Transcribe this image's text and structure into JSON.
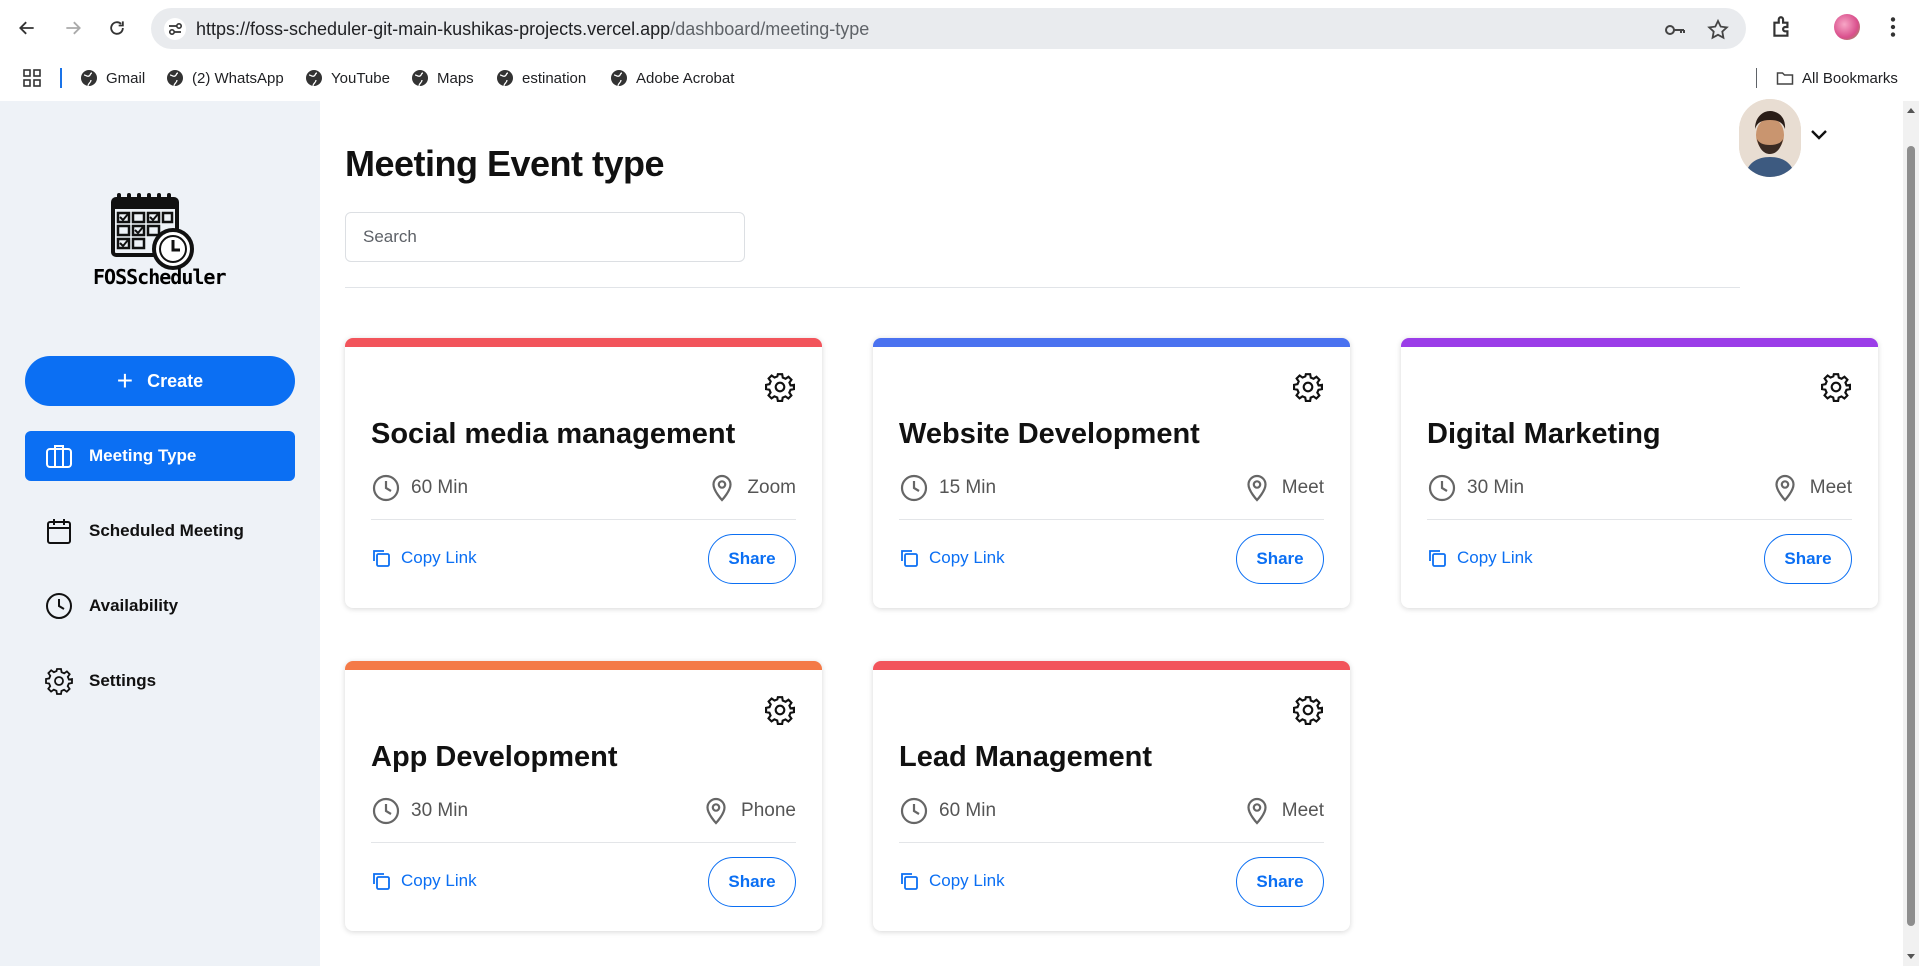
{
  "browser": {
    "url_host": "https://foss-scheduler-git-main-kushikas-projects.vercel.app",
    "url_path": "/dashboard/meeting-type",
    "bookmarks": [
      "Gmail",
      "(2) WhatsApp",
      "YouTube",
      "Maps",
      "estination",
      "Adobe Acrobat"
    ],
    "all_bookmarks_label": "All Bookmarks"
  },
  "sidebar": {
    "logo_text": "FOSScheduler",
    "create_label": "Create",
    "items": [
      {
        "label": "Meeting Type",
        "icon": "briefcase-icon",
        "active": true
      },
      {
        "label": "Scheduled Meeting",
        "icon": "calendar-icon",
        "active": false
      },
      {
        "label": "Availability",
        "icon": "clock-icon",
        "active": false
      },
      {
        "label": "Settings",
        "icon": "gear-icon",
        "active": false
      }
    ]
  },
  "main": {
    "title": "Meeting Event type",
    "search_placeholder": "Search",
    "copy_link_label": "Copy Link",
    "share_label": "Share",
    "cards": [
      {
        "title": "Social media management",
        "duration": "60 Min",
        "location": "Zoom",
        "color": "#f2545b"
      },
      {
        "title": "Website Development",
        "duration": "15 Min",
        "location": "Meet",
        "color": "#4a72f0"
      },
      {
        "title": "Digital Marketing",
        "duration": "30 Min",
        "location": "Meet",
        "color": "#9b3de8"
      },
      {
        "title": "App Development",
        "duration": "30 Min",
        "location": "Phone",
        "color": "#f47a47"
      },
      {
        "title": "Lead Management",
        "duration": "60 Min",
        "location": "Meet",
        "color": "#f2545b"
      }
    ]
  },
  "colors": {
    "accent": "#0b6ff3",
    "sidebar_bg": "#eef2f7"
  }
}
